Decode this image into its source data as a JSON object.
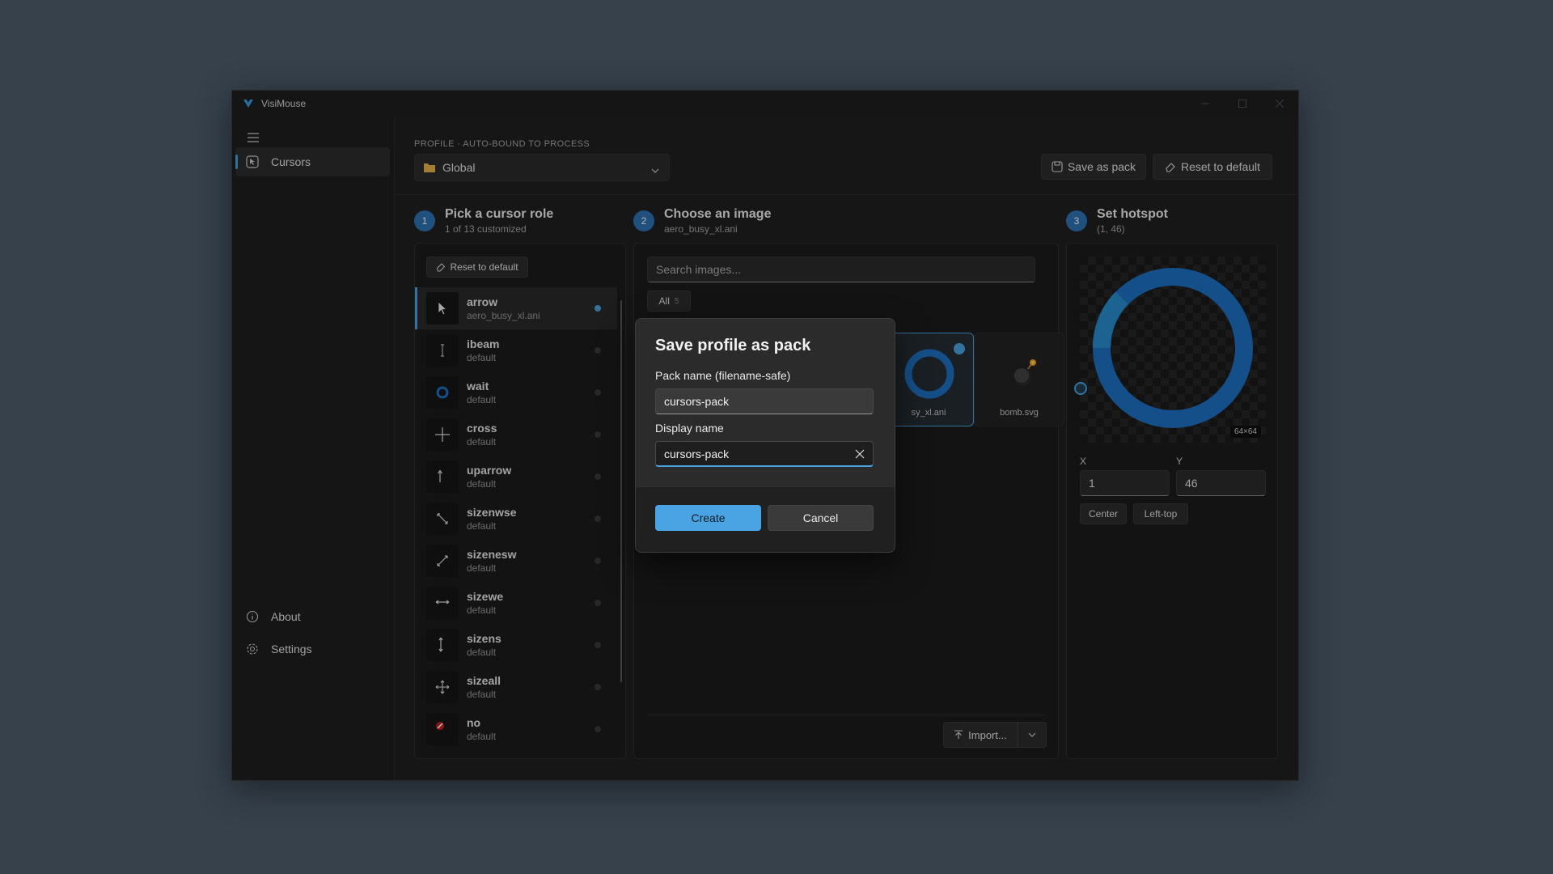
{
  "window": {
    "title": "VisiMouse"
  },
  "sidebar": {
    "items": [
      {
        "label": "Cursors",
        "icon": "cursors-icon",
        "selected": true
      }
    ],
    "footer": [
      {
        "label": "About",
        "icon": "info-icon"
      },
      {
        "label": "Settings",
        "icon": "gear-icon"
      }
    ]
  },
  "header": {
    "overline": "PROFILE · AUTO-BOUND TO PROCESS",
    "profile_value": "Global",
    "save_pack_label": "Save as pack",
    "reset_label": "Reset to default"
  },
  "steps": [
    {
      "num": "1",
      "title": "Pick a cursor role",
      "subtitle": "1 of 13 customized"
    },
    {
      "num": "2",
      "title": "Choose an image",
      "subtitle": "aero_busy_xl.ani"
    },
    {
      "num": "3",
      "title": "Set hotspot",
      "subtitle": "(1, 46)"
    }
  ],
  "roles_panel": {
    "reset_label": "Reset to default",
    "roles": [
      {
        "name": "arrow",
        "sub": "aero_busy_xl.ani",
        "icon": "arrow-cursor-icon"
      },
      {
        "name": "ibeam",
        "sub": "default",
        "icon": "ibeam-cursor-icon"
      },
      {
        "name": "wait",
        "sub": "default",
        "icon": "wait-cursor-icon"
      },
      {
        "name": "cross",
        "sub": "default",
        "icon": "cross-cursor-icon"
      },
      {
        "name": "uparrow",
        "sub": "default",
        "icon": "uparrow-cursor-icon"
      },
      {
        "name": "sizenwse",
        "sub": "default",
        "icon": "sizenwse-cursor-icon"
      },
      {
        "name": "sizenesw",
        "sub": "default",
        "icon": "sizenesw-cursor-icon"
      },
      {
        "name": "sizewe",
        "sub": "default",
        "icon": "sizewe-cursor-icon"
      },
      {
        "name": "sizens",
        "sub": "default",
        "icon": "sizens-cursor-icon"
      },
      {
        "name": "sizeall",
        "sub": "default",
        "icon": "sizeall-cursor-icon"
      },
      {
        "name": "no",
        "sub": "default",
        "icon": "no-cursor-icon"
      }
    ]
  },
  "images_panel": {
    "search_placeholder": "Search images...",
    "filter_label": "All",
    "filter_count": "5",
    "cards": [
      {
        "label": "sy_xl.ani",
        "icon": "busy-ring-icon",
        "selected": true
      },
      {
        "label": "bomb.svg",
        "icon": "bomb-icon",
        "selected": false
      }
    ],
    "import_label": "Import..."
  },
  "hotspot": {
    "size_badge": "64×64",
    "x_label": "X",
    "y_label": "Y",
    "x_value": "1",
    "y_value": "46",
    "center_label": "Center",
    "lefttop_label": "Left-top"
  },
  "dialog": {
    "title": "Save profile as pack",
    "pack_label": "Pack name (filename-safe)",
    "pack_value": "cursors-pack",
    "display_label": "Display name",
    "display_value": "cursors-pack",
    "create_label": "Create",
    "cancel_label": "Cancel"
  },
  "colors": {
    "accent": "#4aa4e3",
    "ring": "#1f72c4",
    "background": "#4e5d6d"
  }
}
